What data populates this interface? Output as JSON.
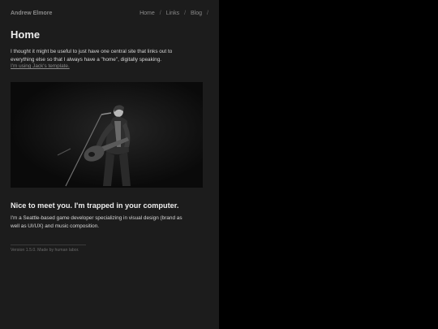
{
  "header": {
    "site_name": "Andrew Elmore",
    "nav": [
      {
        "label": "Home"
      },
      {
        "label": "Links"
      },
      {
        "label": "Blog"
      }
    ],
    "separator": "/"
  },
  "main": {
    "title": "Home",
    "intro": "I thought it might be useful to just have one central site that links out to everything else so that I always have a \"home\", digitally speaking.",
    "intro_link": "I'm using Jack's template.",
    "bio_heading": "Nice to meet you. I'm trapped in your computer.",
    "bio": "I'm a Seattle-based game developer specializing in visual design (brand as well as UI/UX) and music composition."
  },
  "footer": {
    "text": "Version 1.5.0. Made by human labor."
  },
  "colors": {
    "panel_bg": "#1c1c1c",
    "page_bg": "#000000",
    "text": "#d8d8d8",
    "muted": "#8a8a8a"
  }
}
